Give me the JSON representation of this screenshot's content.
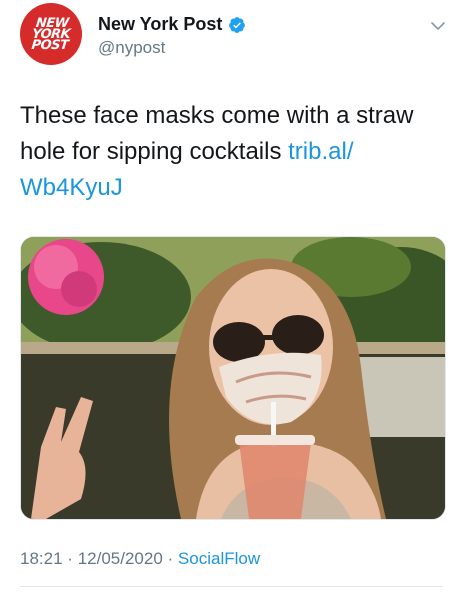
{
  "account": {
    "display_name": "New York Post",
    "handle": "@nypost",
    "avatar_text": [
      "NEW",
      "YORK",
      "POST"
    ],
    "verified": true
  },
  "tweet": {
    "text": "These face masks come with a straw hole for sipping cocktails ",
    "link": "trib.al/​Wb4KyuJ",
    "time": "18:21",
    "separator": "·",
    "date": "12/05/2020",
    "source": "SocialFlow"
  },
  "colors": {
    "link": "#1b95e0",
    "secondary": "#657786",
    "avatar_bg": "#d62b2b",
    "verified": "#1da1f2"
  },
  "icons": {
    "verified": "verified-badge-icon",
    "menu": "chevron-down-icon"
  }
}
